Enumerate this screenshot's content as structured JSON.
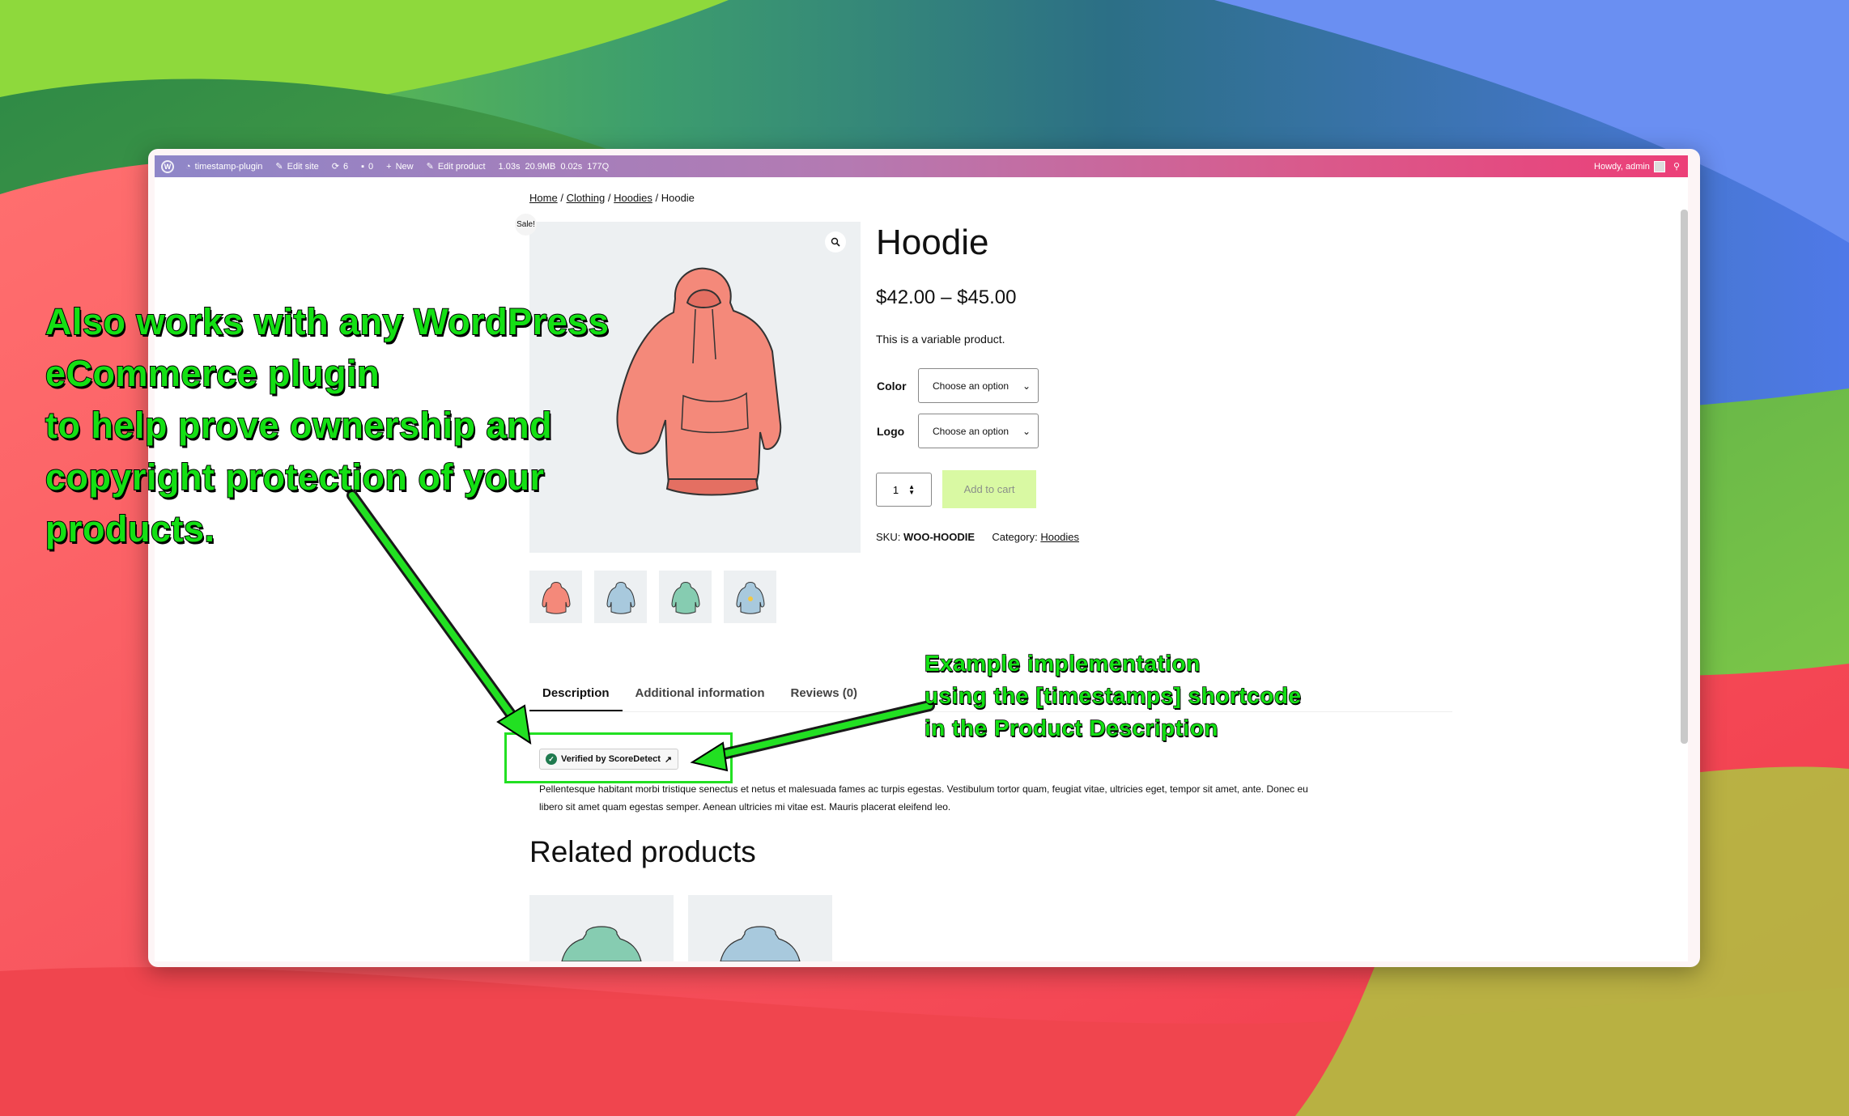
{
  "admin_bar": {
    "site_name": "timestamp-plugin",
    "edit_site": "Edit site",
    "updates_count": "6",
    "comments_count": "0",
    "new_label": "New",
    "edit_product": "Edit product",
    "perf_time": "1.03s",
    "perf_memory": "20.9MB",
    "perf_db_time": "0.02s",
    "perf_queries": "177Q",
    "howdy": "Howdy, admin"
  },
  "breadcrumb": {
    "home": "Home",
    "clothing": "Clothing",
    "hoodies": "Hoodies",
    "current": "Hoodie",
    "sep": "/"
  },
  "product": {
    "sale_badge": "Sale!",
    "title": "Hoodie",
    "price": "$42.00 – $45.00",
    "short_description": "This is a variable product.",
    "color_label": "Color",
    "color_value": "Choose an option",
    "logo_label": "Logo",
    "logo_value": "Choose an option",
    "quantity": "1",
    "add_to_cart": "Add to cart",
    "sku_label": "SKU:",
    "sku_value": "WOO-HOODIE",
    "category_label": "Category:",
    "category_value": "Hoodies"
  },
  "thumbnails": [
    {
      "color": "#f4897a"
    },
    {
      "color": "#a8c9dd"
    },
    {
      "color": "#86ccb1"
    },
    {
      "color": "#a8c9dd"
    }
  ],
  "tabs": {
    "description": "Description",
    "additional": "Additional information",
    "reviews": "Reviews (0)"
  },
  "verified_badge": {
    "label": "Verified by ScoreDetect",
    "external_icon": "↗"
  },
  "description_text": "Pellentesque habitant morbi tristique senectus et netus et malesuada fames ac turpis egestas. Vestibulum tortor quam, feugiat vitae, ultricies eget, tempor sit amet, ante. Donec eu libero sit amet quam egestas semper. Aenean ultricies mi vitae est. Mauris placerat eleifend leo.",
  "related": {
    "heading": "Related products",
    "cards": [
      {
        "color": "#86ccb1"
      },
      {
        "color": "#a8c9dd"
      }
    ]
  },
  "annotations": {
    "left_lines": [
      "Also works with any WordPress",
      "eCommerce plugin",
      "to help prove ownership and",
      "copyright protection of your",
      "products."
    ],
    "right_lines": [
      "Example implementation",
      "using the [timestamps] shortcode",
      "in the Product Description"
    ]
  },
  "colors": {
    "annotation_green": "#14e014",
    "admin_bar_start": "#8e86c8",
    "admin_bar_end": "#ec3f78",
    "add_to_cart_bg": "#d9f9a3",
    "product_bg": "#edf0f2",
    "hoodie": "#f4897a"
  }
}
